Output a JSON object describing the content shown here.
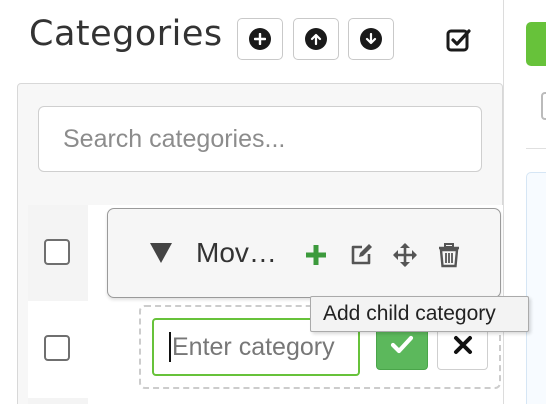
{
  "header": {
    "title": "Categories",
    "buttons": [
      {
        "name": "add-root",
        "icon": "plus-circle-icon"
      },
      {
        "name": "move-up",
        "icon": "arrow-up-circle-icon"
      },
      {
        "name": "move-down",
        "icon": "arrow-down-circle-icon"
      }
    ],
    "select_all_icon": "checkbox-checked-icon"
  },
  "search": {
    "placeholder": "Search categories..."
  },
  "tree": {
    "items": [
      {
        "label": "Mov…",
        "expanded": true,
        "actions": [
          "add-child-icon",
          "edit-icon",
          "move-icon",
          "delete-icon"
        ]
      }
    ],
    "tooltip": "Add child category",
    "new_category": {
      "value": "",
      "placeholder": "Enter category"
    }
  },
  "colors": {
    "accent_green": "#67c23a",
    "confirm_green": "#5cb85c",
    "add_icon_green": "#3c9a3c"
  }
}
